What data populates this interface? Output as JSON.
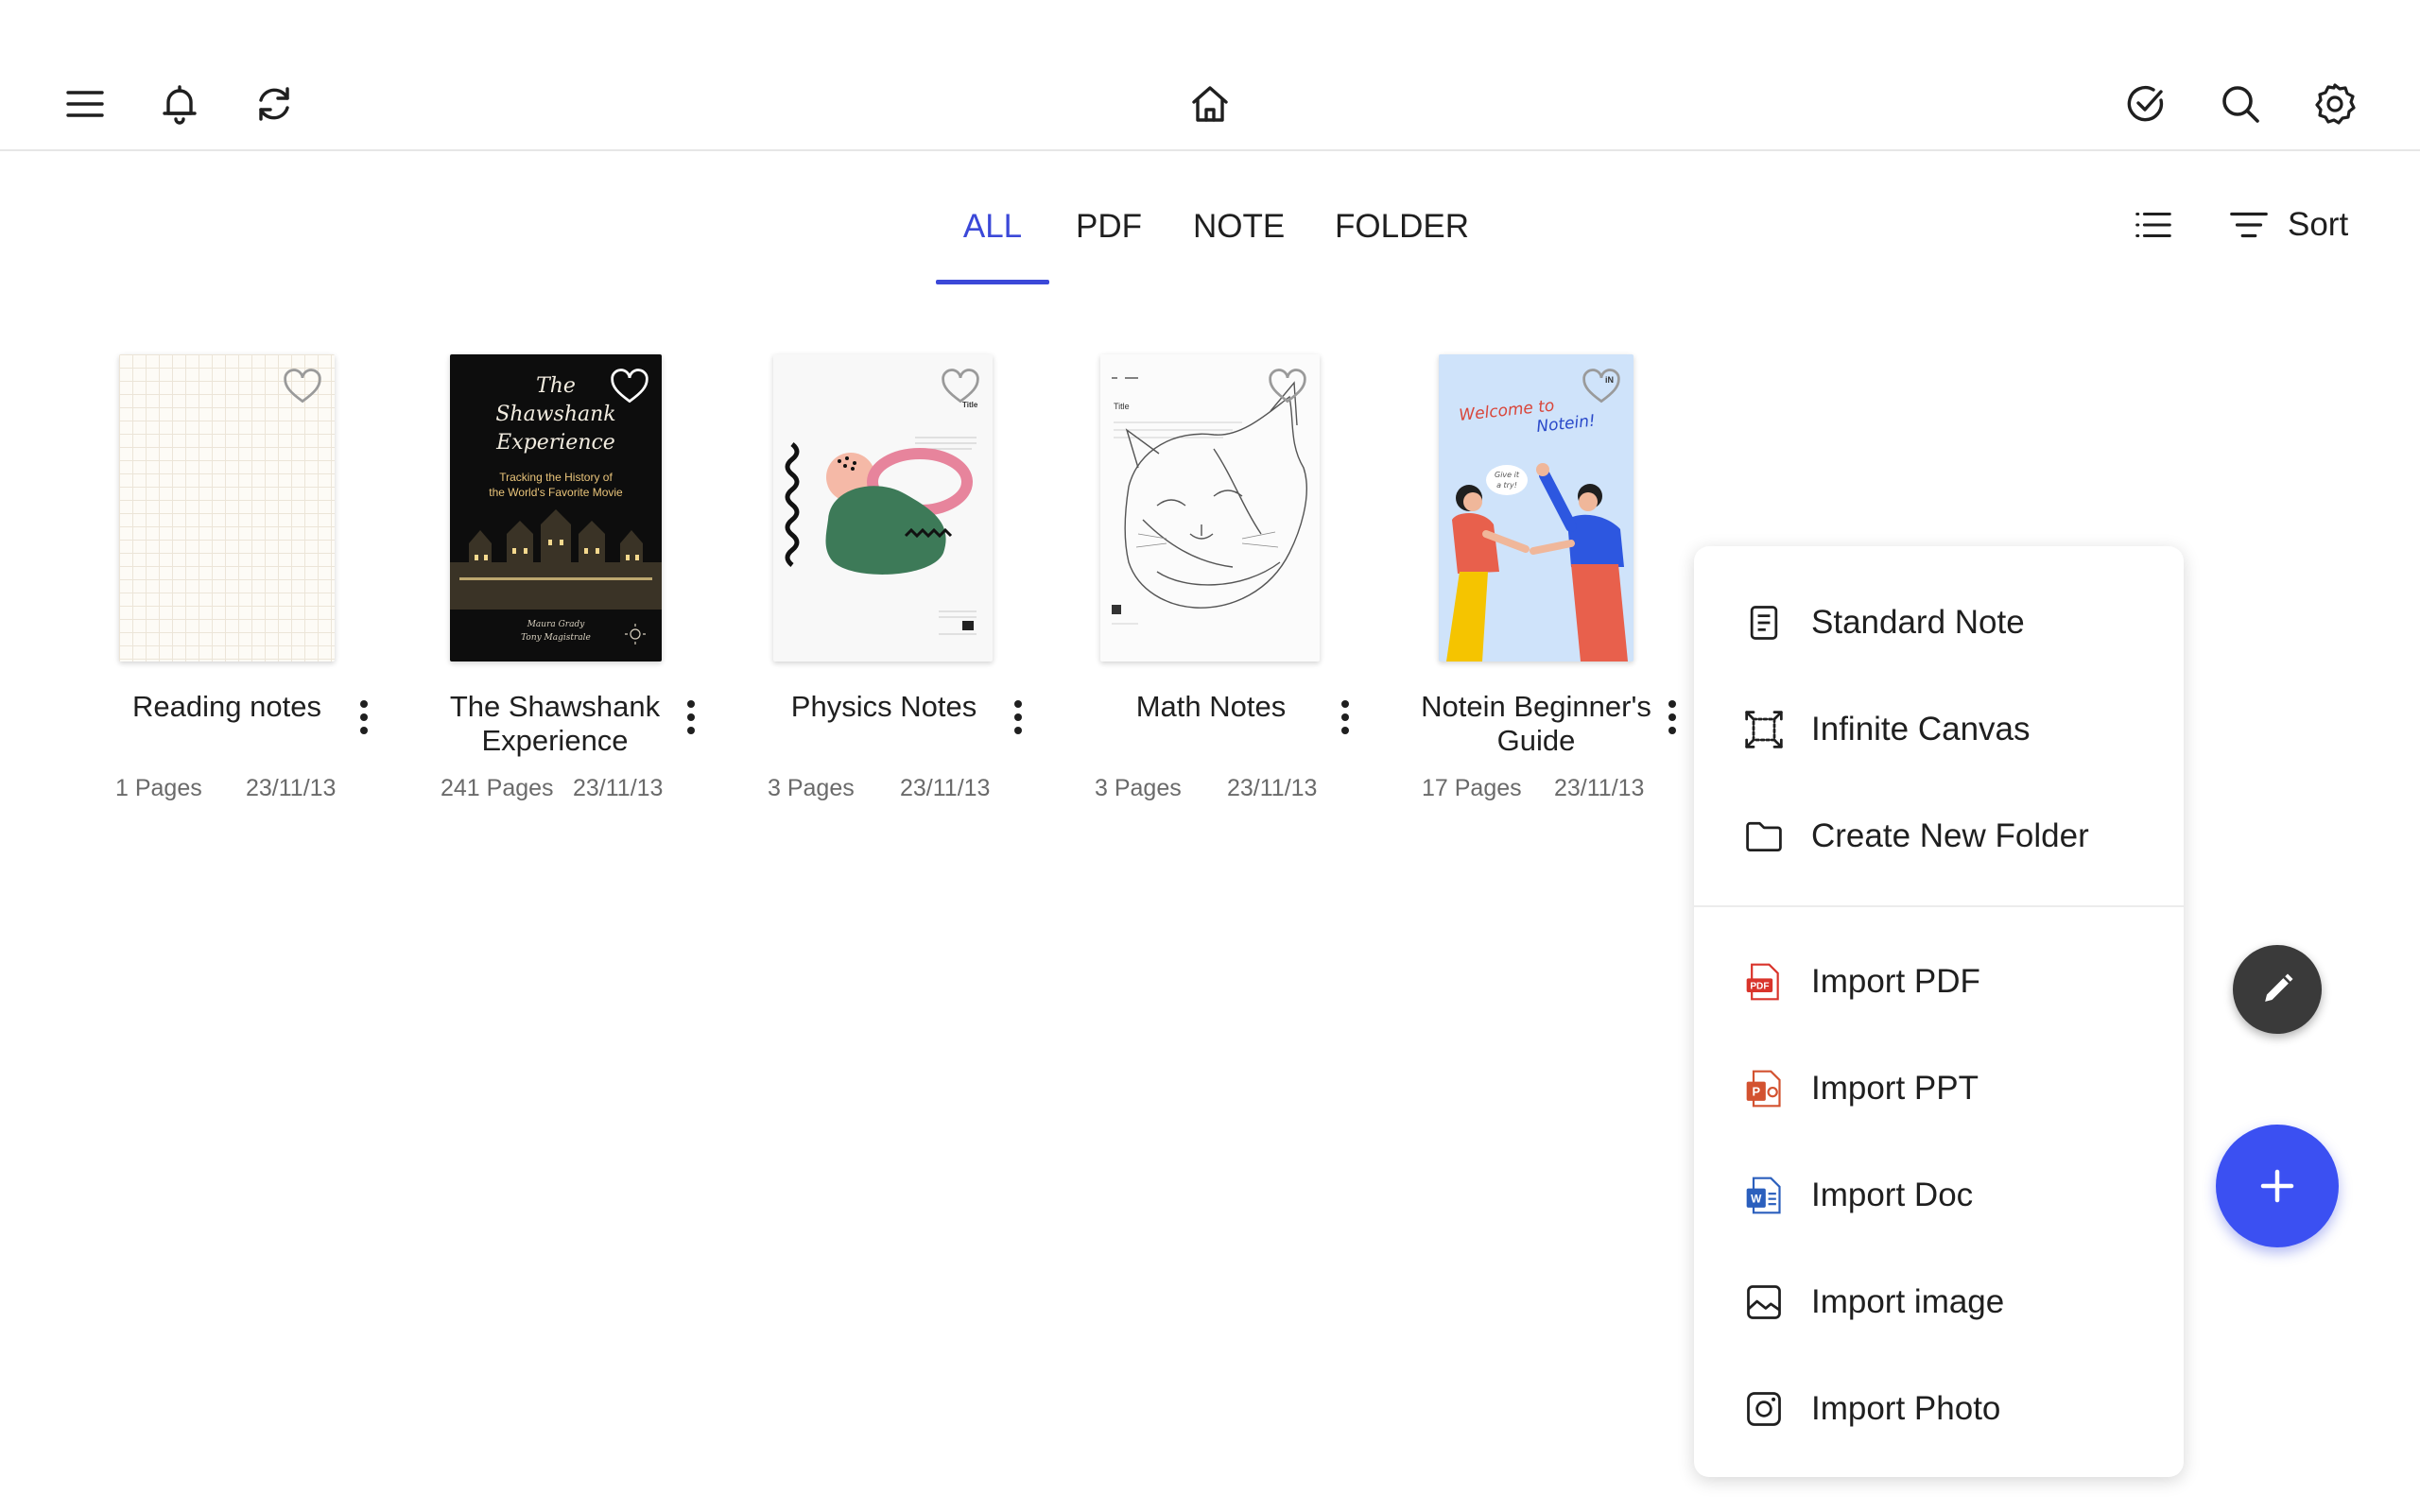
{
  "tabs": [
    "ALL",
    "PDF",
    "NOTE",
    "FOLDER"
  ],
  "active_tab": "ALL",
  "sort_label": "Sort",
  "files": [
    {
      "title": "Reading notes",
      "pages": "1 Pages",
      "date": "23/11/13"
    },
    {
      "title": "The Shawshank Experience",
      "pages": "241 Pages",
      "date": "23/11/13"
    },
    {
      "title": "Physics Notes",
      "pages": "3 Pages",
      "date": "23/11/13"
    },
    {
      "title": "Math Notes",
      "pages": "3 Pages",
      "date": "23/11/13"
    },
    {
      "title": "Notein Beginner's Guide",
      "pages": "17 Pages",
      "date": "23/11/13"
    }
  ],
  "covers": {
    "shawshank_title": [
      "The",
      "Shawshank",
      "Experience"
    ],
    "shawshank_subtitle": [
      "Tracking the History of",
      "the World's Favorite Movie"
    ],
    "shawshank_authors": [
      "Maura Grady",
      "Tony Magistrale"
    ],
    "notein_welcome": [
      "Welcome to",
      "Notein!"
    ],
    "notein_bubble": [
      "Give it",
      "a try!"
    ],
    "title_label": "Title"
  },
  "menu": {
    "create": [
      {
        "label": "Standard Note",
        "icon": "note-icon"
      },
      {
        "label": "Infinite Canvas",
        "icon": "canvas-icon"
      },
      {
        "label": "Create New Folder",
        "icon": "folder-icon"
      }
    ],
    "import": [
      {
        "label": "Import PDF",
        "icon": "pdf-icon"
      },
      {
        "label": "Import PPT",
        "icon": "ppt-icon"
      },
      {
        "label": "Import Doc",
        "icon": "doc-icon"
      },
      {
        "label": "Import image",
        "icon": "image-icon"
      },
      {
        "label": "Import Photo",
        "icon": "camera-icon"
      }
    ]
  },
  "colors": {
    "accent": "#3b48d8",
    "fab_add": "#3b50f2",
    "fab_pen": "#3a3a3a",
    "pdf_red": "#d9342b",
    "ppt_orange": "#d35230",
    "doc_blue": "#2b5fbd"
  }
}
